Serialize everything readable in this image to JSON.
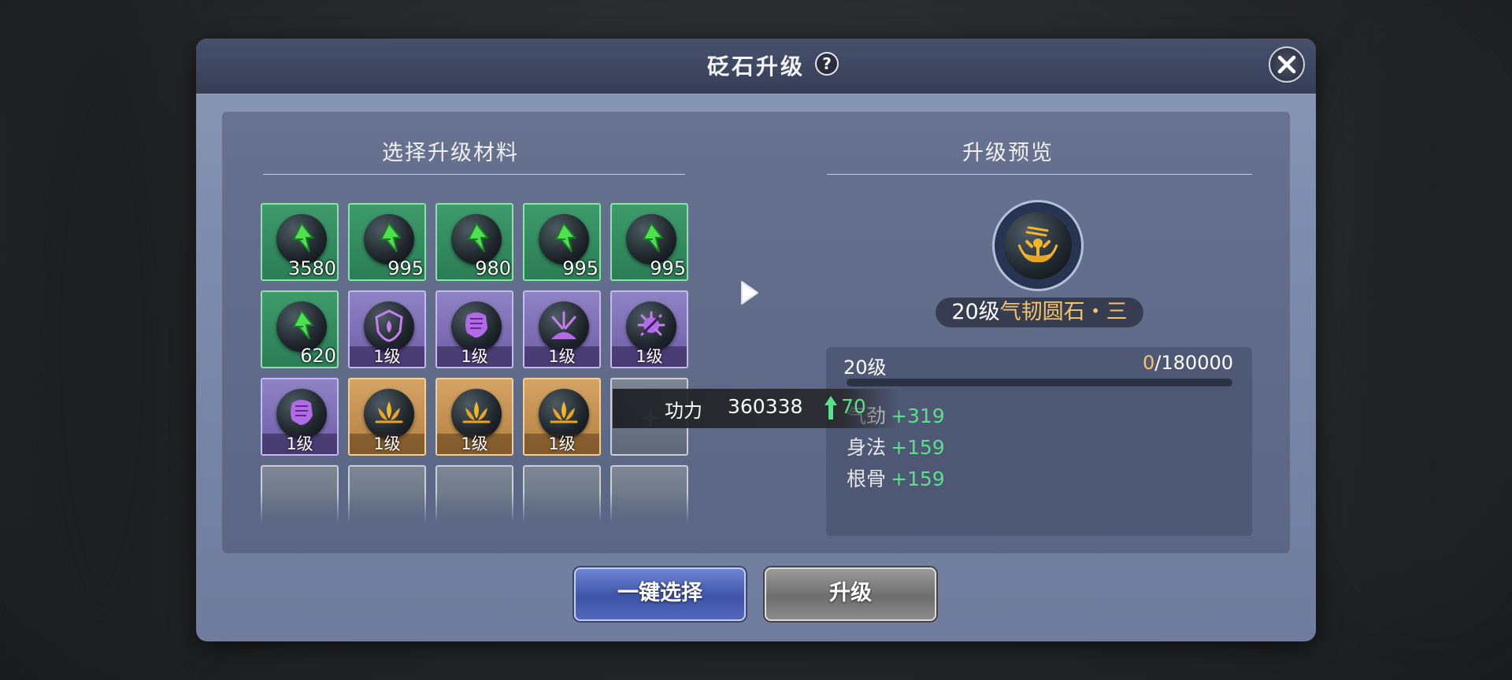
{
  "dialog": {
    "title": "砭石升级",
    "help_label": "?"
  },
  "materials": {
    "title": "选择升级材料",
    "slots": [
      {
        "type": "exp-stone",
        "count": "3580"
      },
      {
        "type": "exp-stone",
        "count": "995"
      },
      {
        "type": "exp-stone",
        "count": "980"
      },
      {
        "type": "exp-stone",
        "count": "995"
      },
      {
        "type": "exp-stone",
        "count": "995"
      },
      {
        "type": "exp-stone",
        "count": "620"
      },
      {
        "type": "shield-stone",
        "level": "1级"
      },
      {
        "type": "fist-stone",
        "level": "1级"
      },
      {
        "type": "burst-stone",
        "level": "1级"
      },
      {
        "type": "bug-stone",
        "level": "1级"
      },
      {
        "type": "fist-stone",
        "level": "1级"
      },
      {
        "type": "lotus-stone",
        "level": "1级"
      },
      {
        "type": "lotus-stone",
        "level": "1级"
      },
      {
        "type": "lotus-stone",
        "level": "1级"
      }
    ]
  },
  "preview": {
    "title": "升级预览",
    "level_prefix": "20级",
    "stone_name": "气韧圆石・三",
    "current_level": "20级",
    "exp_current": "0",
    "exp_total": "/180000",
    "exp_fraction": 0,
    "stats": [
      {
        "name": "气劲",
        "value": "+319"
      },
      {
        "name": "身法",
        "value": "+159"
      },
      {
        "name": "根骨",
        "value": "+159"
      }
    ]
  },
  "tooltip": {
    "label": "功力",
    "value": "360338",
    "delta": "70"
  },
  "buttons": {
    "auto_select": "一键选择",
    "upgrade": "升级"
  },
  "colors": {
    "accent_gold": "#f3c46a",
    "stat_green": "#58e08a",
    "exp_slot": "#2a7d55",
    "purple_slot": "#6d5ea7",
    "gold_slot": "#b2803f"
  }
}
